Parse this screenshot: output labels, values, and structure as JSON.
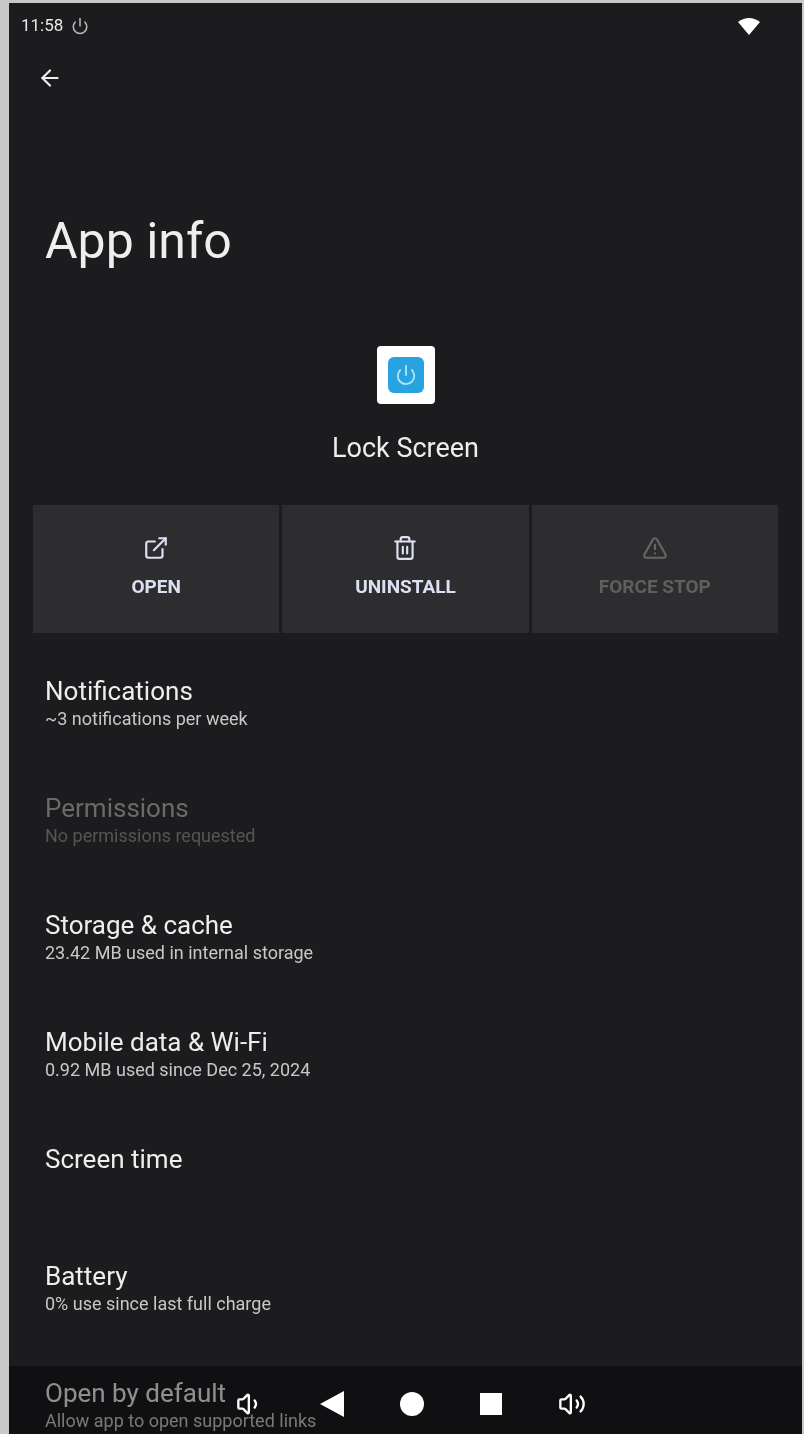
{
  "status_bar": {
    "time": "11:58"
  },
  "title": "App info",
  "app": {
    "name": "Lock Screen"
  },
  "actions": [
    {
      "kind": "open",
      "label": "OPEN",
      "disabled": false
    },
    {
      "kind": "uninstall",
      "label": "UNINSTALL",
      "disabled": false
    },
    {
      "kind": "force_stop",
      "label": "FORCE STOP",
      "disabled": true
    }
  ],
  "settings": [
    {
      "title": "Notifications",
      "subtitle": "~3 notifications per week",
      "disabled": false
    },
    {
      "title": "Permissions",
      "subtitle": "No permissions requested",
      "disabled": true
    },
    {
      "title": "Storage & cache",
      "subtitle": "23.42 MB used in internal storage",
      "disabled": false
    },
    {
      "title": "Mobile data & Wi-Fi",
      "subtitle": "0.92 MB used since Dec 25, 2024",
      "disabled": false
    },
    {
      "title": "Screen time",
      "disabled": false
    },
    {
      "title": "Battery",
      "subtitle": "0% use since last full charge",
      "disabled": false
    },
    {
      "title": "Open by default",
      "subtitle": "Allow app to open supported links",
      "disabled": false
    }
  ]
}
